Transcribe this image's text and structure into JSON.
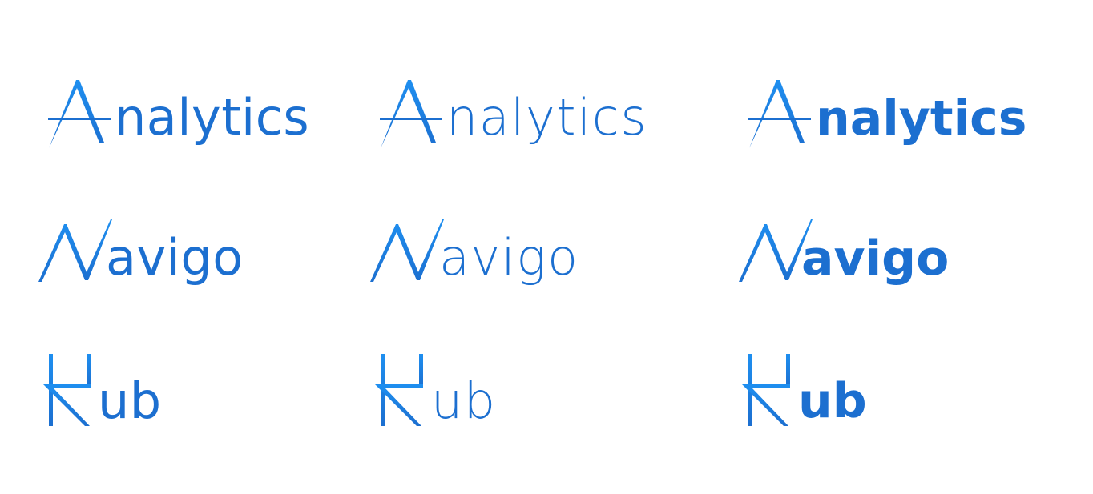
{
  "colors": {
    "brand_blue": "#1c6fd0",
    "brand_light": "#1e8ff0",
    "background": "#ffffff"
  },
  "logos": [
    {
      "mark": "A-mark-icon",
      "variants": [
        {
          "weight": "regular",
          "rest": "nalytics"
        },
        {
          "weight": "light",
          "rest": "nalytics"
        },
        {
          "weight": "bold",
          "rest": "nalytics"
        }
      ]
    },
    {
      "mark": "N-mark-icon",
      "variants": [
        {
          "weight": "regular",
          "rest": "avigo"
        },
        {
          "weight": "light",
          "rest": "avigo"
        },
        {
          "weight": "bold",
          "rest": "avigo"
        }
      ]
    },
    {
      "mark": "H-mark-icon",
      "variants": [
        {
          "weight": "regular",
          "rest": "ub"
        },
        {
          "weight": "light",
          "rest": "ub"
        },
        {
          "weight": "bold",
          "rest": "ub"
        }
      ]
    }
  ]
}
